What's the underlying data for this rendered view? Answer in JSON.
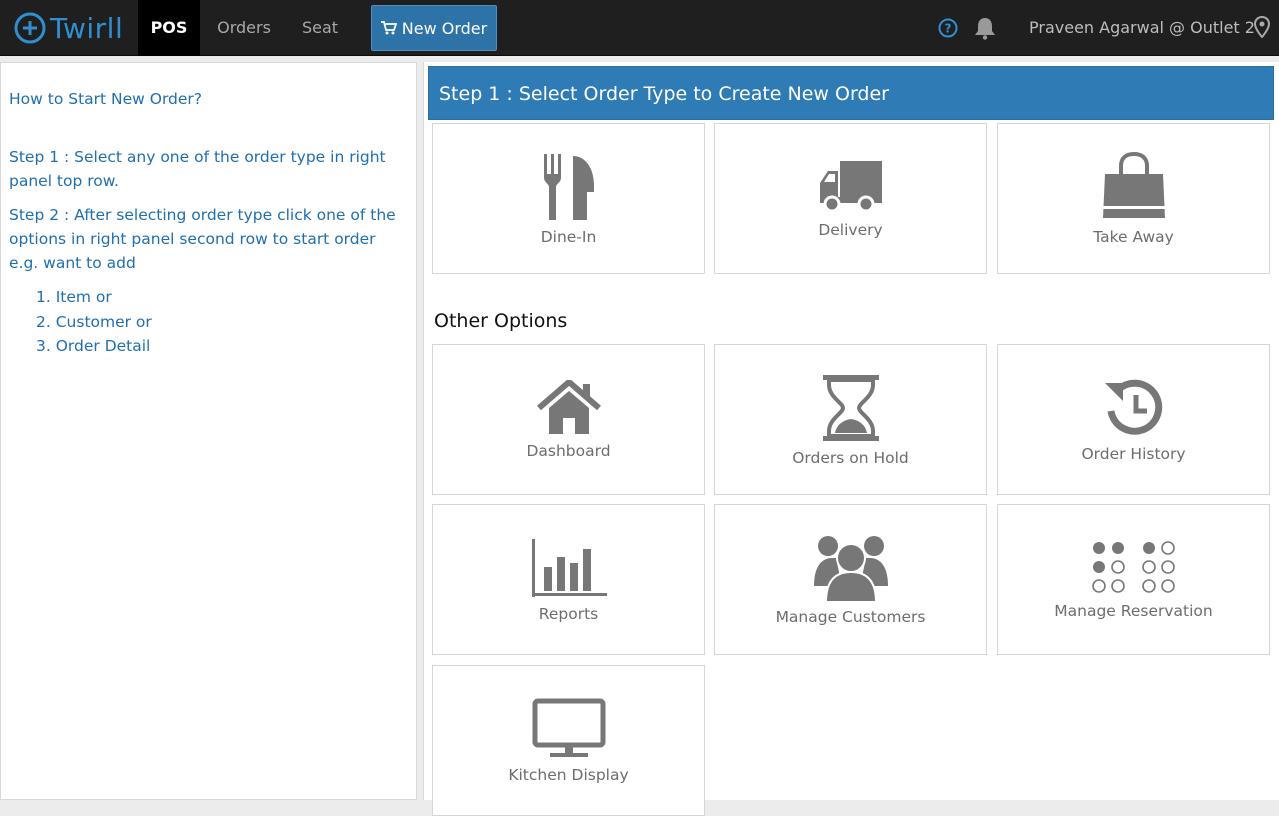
{
  "header": {
    "logo_text": "Twirll",
    "nav": {
      "pos": "POS",
      "orders": "Orders",
      "seat": "Seat",
      "new_order": "New Order"
    },
    "user": "Praveen Agarwal @ Outlet 2"
  },
  "left_panel": {
    "title": "How to Start New Order?",
    "step1_label": "Step 1 :",
    "step1_text": " Select any one of the order type in right panel top row.",
    "step2_label": "Step 2 :",
    "step2_text": " After selecting order type click one of the options in right panel second row to start order e.g. want to add",
    "list": [
      "1. Item or",
      "2. Customer or",
      "3. Order Detail"
    ]
  },
  "right_panel": {
    "step_header": "Step 1 : Select Order Type to Create New Order",
    "order_types": [
      "Dine-In",
      "Delivery",
      "Take Away"
    ],
    "other_title": "Other Options",
    "other_options": [
      "Dashboard",
      "Orders on Hold",
      "Order History",
      "Reports",
      "Manage Customers",
      "Manage Reservation",
      "Kitchen Display"
    ]
  },
  "colors": {
    "accent": "#2f7bb6",
    "topbar": "#1f1f1f",
    "icon": "#777777",
    "text_blue": "#1f6fb0"
  }
}
